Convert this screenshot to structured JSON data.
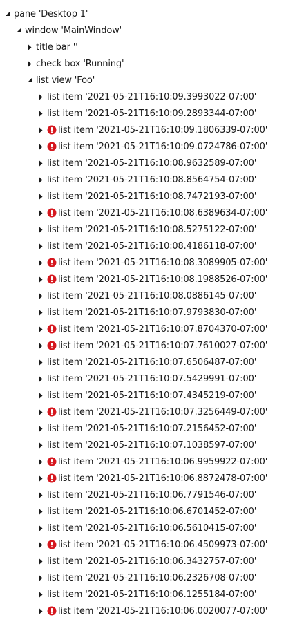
{
  "tree": {
    "pane": {
      "label": "pane 'Desktop 1'",
      "expanded": true
    },
    "window": {
      "label": "window 'MainWindow'",
      "expanded": true
    },
    "window_children": [
      {
        "label": "title bar ''",
        "expanded": false
      },
      {
        "label": "check box 'Running'",
        "expanded": false
      }
    ],
    "list_view": {
      "label": "list view 'Foo'",
      "expanded": true
    },
    "list_items": [
      {
        "label": "list item '2021-05-21T16:10:09.3993022-07:00'",
        "error": false
      },
      {
        "label": "list item '2021-05-21T16:10:09.2893344-07:00'",
        "error": false
      },
      {
        "label": "list item '2021-05-21T16:10:09.1806339-07:00'",
        "error": true
      },
      {
        "label": "list item '2021-05-21T16:10:09.0724786-07:00'",
        "error": true
      },
      {
        "label": "list item '2021-05-21T16:10:08.9632589-07:00'",
        "error": false
      },
      {
        "label": "list item '2021-05-21T16:10:08.8564754-07:00'",
        "error": false
      },
      {
        "label": "list item '2021-05-21T16:10:08.7472193-07:00'",
        "error": false
      },
      {
        "label": "list item '2021-05-21T16:10:08.6389634-07:00'",
        "error": true
      },
      {
        "label": "list item '2021-05-21T16:10:08.5275122-07:00'",
        "error": false
      },
      {
        "label": "list item '2021-05-21T16:10:08.4186118-07:00'",
        "error": false
      },
      {
        "label": "list item '2021-05-21T16:10:08.3089905-07:00'",
        "error": true
      },
      {
        "label": "list item '2021-05-21T16:10:08.1988526-07:00'",
        "error": true
      },
      {
        "label": "list item '2021-05-21T16:10:08.0886145-07:00'",
        "error": false
      },
      {
        "label": "list item '2021-05-21T16:10:07.9793830-07:00'",
        "error": false
      },
      {
        "label": "list item '2021-05-21T16:10:07.8704370-07:00'",
        "error": true
      },
      {
        "label": "list item '2021-05-21T16:10:07.7610027-07:00'",
        "error": true
      },
      {
        "label": "list item '2021-05-21T16:10:07.6506487-07:00'",
        "error": false
      },
      {
        "label": "list item '2021-05-21T16:10:07.5429991-07:00'",
        "error": false
      },
      {
        "label": "list item '2021-05-21T16:10:07.4345219-07:00'",
        "error": false
      },
      {
        "label": "list item '2021-05-21T16:10:07.3256449-07:00'",
        "error": true
      },
      {
        "label": "list item '2021-05-21T16:10:07.2156452-07:00'",
        "error": false
      },
      {
        "label": "list item '2021-05-21T16:10:07.1038597-07:00'",
        "error": false
      },
      {
        "label": "list item '2021-05-21T16:10:06.9959922-07:00'",
        "error": true
      },
      {
        "label": "list item '2021-05-21T16:10:06.8872478-07:00'",
        "error": true
      },
      {
        "label": "list item '2021-05-21T16:10:06.7791546-07:00'",
        "error": false
      },
      {
        "label": "list item '2021-05-21T16:10:06.6701452-07:00'",
        "error": false
      },
      {
        "label": "list item '2021-05-21T16:10:06.5610415-07:00'",
        "error": false
      },
      {
        "label": "list item '2021-05-21T16:10:06.4509973-07:00'",
        "error": true
      },
      {
        "label": "list item '2021-05-21T16:10:06.3432757-07:00'",
        "error": false
      },
      {
        "label": "list item '2021-05-21T16:10:06.2326708-07:00'",
        "error": false
      },
      {
        "label": "list item '2021-05-21T16:10:06.1255184-07:00'",
        "error": false
      },
      {
        "label": "list item '2021-05-21T16:10:06.0020077-07:00'",
        "error": true
      }
    ]
  },
  "icons": {
    "expanded": "expanded-arrow-icon",
    "collapsed": "collapsed-arrow-icon",
    "error": "error-icon"
  },
  "colors": {
    "text": "#1a1a1a",
    "arrow": "#1a1a1a",
    "error": "#d6171e"
  }
}
